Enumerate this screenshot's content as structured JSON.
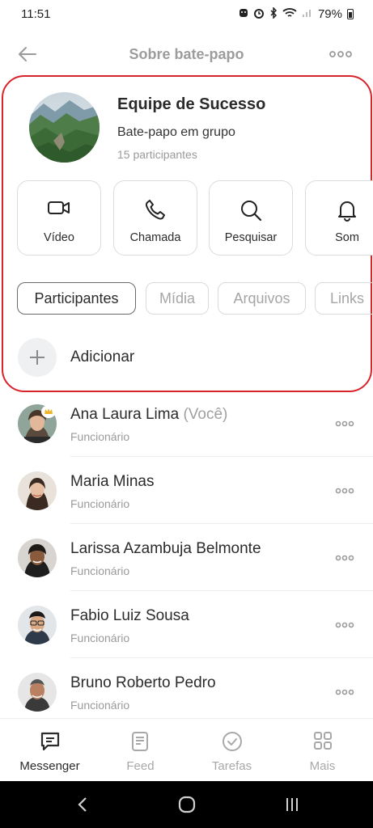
{
  "status_bar": {
    "time": "11:51",
    "battery": "79%"
  },
  "header": {
    "title": "Sobre bate-papo"
  },
  "group": {
    "name": "Equipe de Sucesso",
    "type": "Bate-papo em grupo",
    "participants": "15 participantes"
  },
  "actions": [
    {
      "label": "Vídeo",
      "icon": "video-camera-icon"
    },
    {
      "label": "Chamada",
      "icon": "phone-icon"
    },
    {
      "label": "Pesquisar",
      "icon": "search-icon"
    },
    {
      "label": "Som",
      "icon": "bell-icon"
    }
  ],
  "tabs": [
    {
      "label": "Participantes",
      "active": true
    },
    {
      "label": "Mídia",
      "active": false
    },
    {
      "label": "Arquivos",
      "active": false
    },
    {
      "label": "Links",
      "active": false
    }
  ],
  "add": {
    "label": "Adicionar"
  },
  "members": [
    {
      "name": "Ana Laura Lima",
      "tag": "(Você)",
      "role": "Funcionário"
    },
    {
      "name": "Maria Minas",
      "tag": "",
      "role": "Funcionário"
    },
    {
      "name": "Larissa Azambuja Belmonte",
      "tag": "",
      "role": "Funcionário"
    },
    {
      "name": "Fabio Luiz Sousa",
      "tag": "",
      "role": "Funcionário"
    },
    {
      "name": "Bruno Roberto Pedro",
      "tag": "",
      "role": "Funcionário"
    }
  ],
  "bottom_nav": [
    {
      "label": "Messenger",
      "icon": "chat-icon",
      "active": true
    },
    {
      "label": "Feed",
      "icon": "feed-icon",
      "active": false
    },
    {
      "label": "Tarefas",
      "icon": "check-circle-icon",
      "active": false
    },
    {
      "label": "Mais",
      "icon": "grid-icon",
      "active": false
    }
  ],
  "colors": {
    "highlight_border": "#d9232a",
    "muted_text": "#9a9a9a",
    "primary_text": "#2b2b2b"
  }
}
